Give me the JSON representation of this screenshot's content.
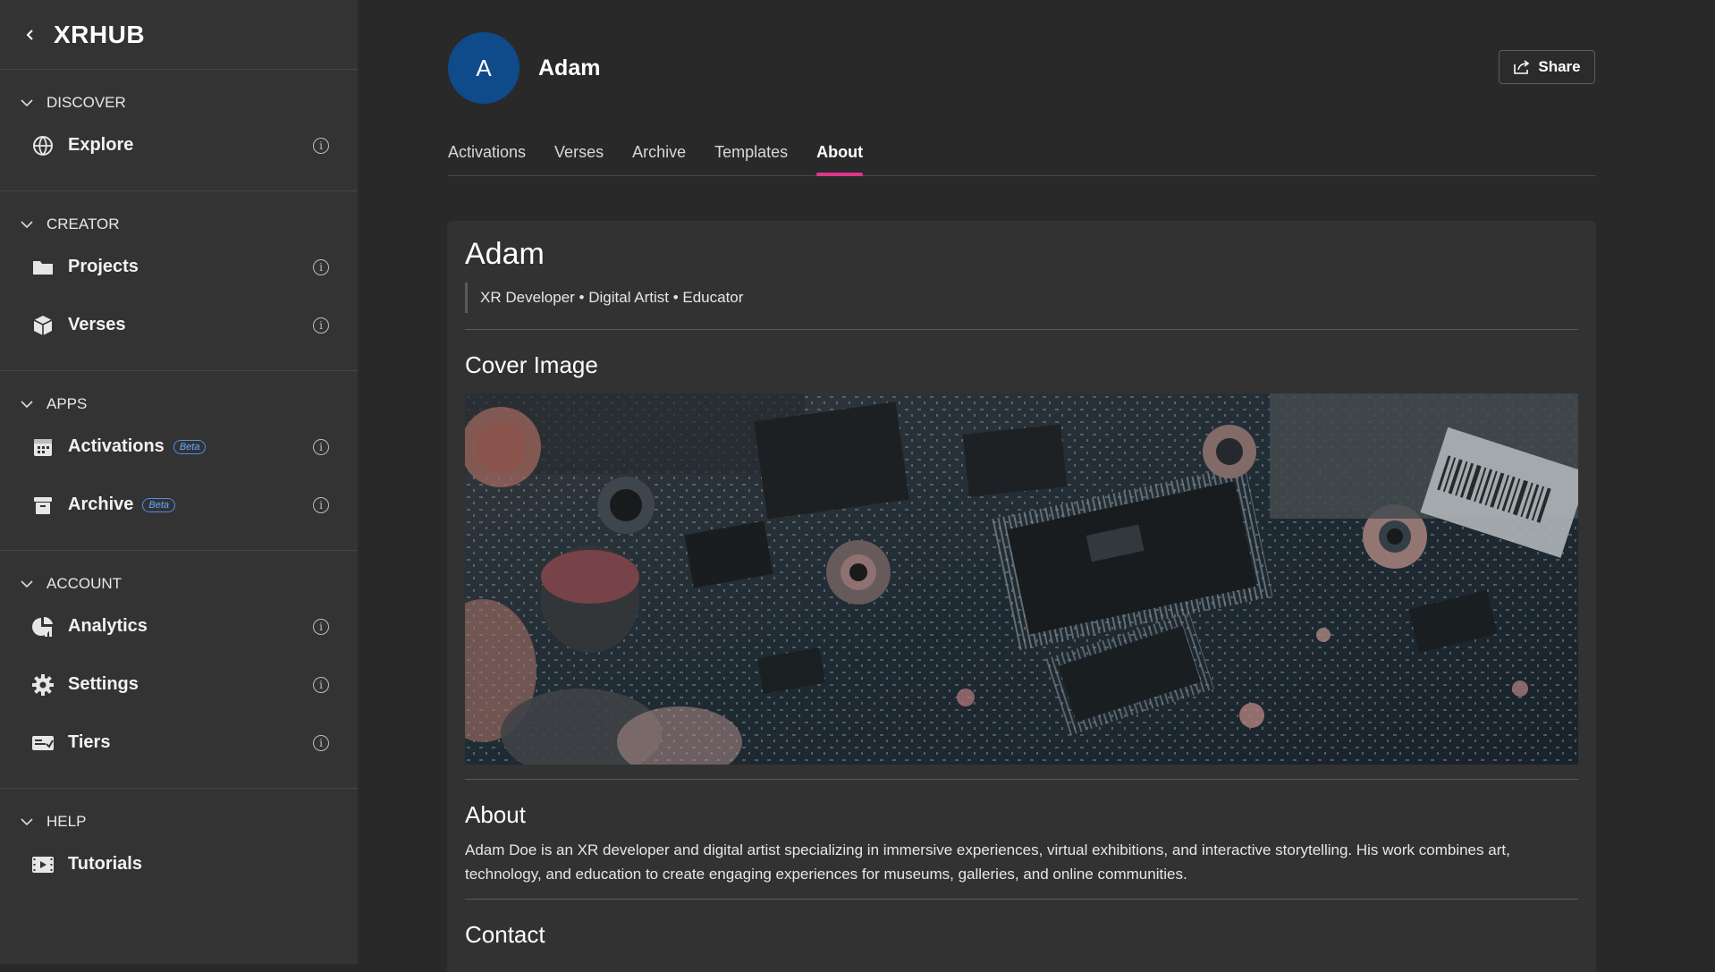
{
  "app": {
    "title": "XRHUB"
  },
  "sidebar": {
    "sections": [
      {
        "title": "DISCOVER",
        "items": [
          {
            "label": "Explore",
            "icon": "globe-icon",
            "beta": ""
          }
        ]
      },
      {
        "title": "CREATOR",
        "items": [
          {
            "label": "Projects",
            "icon": "folder-icon",
            "beta": ""
          },
          {
            "label": "Verses",
            "icon": "cube-icon",
            "beta": ""
          }
        ]
      },
      {
        "title": "APPS",
        "items": [
          {
            "label": "Activations",
            "icon": "calendar-icon",
            "beta": "Beta"
          },
          {
            "label": "Archive",
            "icon": "archive-icon",
            "beta": "Beta"
          }
        ]
      },
      {
        "title": "ACCOUNT",
        "items": [
          {
            "label": "Analytics",
            "icon": "analytics-icon",
            "beta": ""
          },
          {
            "label": "Settings",
            "icon": "gear-icon",
            "beta": ""
          },
          {
            "label": "Tiers",
            "icon": "ticket-icon",
            "beta": ""
          }
        ]
      },
      {
        "title": "HELP",
        "items": [
          {
            "label": "Tutorials",
            "icon": "video-icon",
            "beta": ""
          }
        ]
      }
    ]
  },
  "profile": {
    "avatar_letter": "A",
    "name": "Adam",
    "share_label": "Share"
  },
  "tabs": [
    "Activations",
    "Verses",
    "Archive",
    "Templates",
    "About"
  ],
  "active_tab": "About",
  "about_card": {
    "title": "Adam",
    "tagline": "XR Developer • Digital Artist • Educator",
    "cover_heading": "Cover Image",
    "about_heading": "About",
    "about_text": "Adam Doe is an XR developer and digital artist specializing in immersive experiences, virtual exhibitions, and interactive storytelling. His work combines art, technology, and education to create engaging experiences for museums, galleries, and online communities.",
    "contact_heading": "Contact"
  },
  "colors": {
    "accent": "#e0348f",
    "avatar_bg": "#0f4a8a",
    "beta_badge": "#4d8fe8"
  }
}
